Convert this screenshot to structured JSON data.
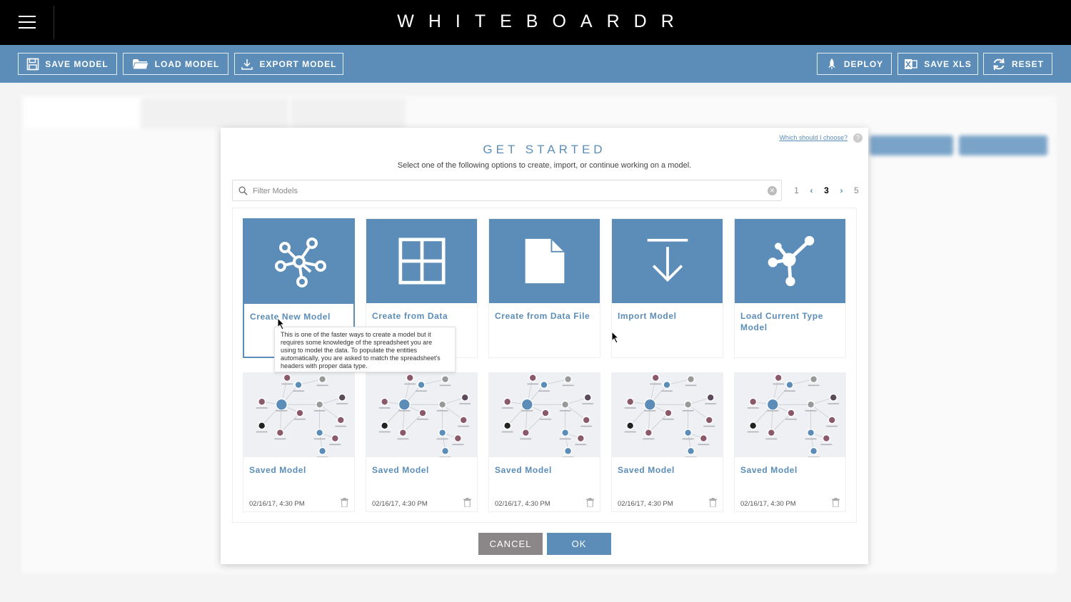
{
  "app": {
    "brand": "WHITEBOARDR"
  },
  "icons": {
    "menu": "hamburger-icon",
    "save": "floppy-icon",
    "load": "folder-icon",
    "export": "download-icon",
    "deploy": "rocket-icon",
    "xls": "excel-icon",
    "reset": "refresh-icon"
  },
  "toolbar": {
    "save_model": "SAVE MODEL",
    "load_model": "LOAD MODEL",
    "export_model": "EXPORT MODEL",
    "deploy": "DEPLOY",
    "save_xls": "SAVE XLS",
    "reset": "RESET"
  },
  "modal": {
    "help_link": "Which should I choose?",
    "title": "GET STARTED",
    "subtitle": "Select one of the following options to create, import, or continue working on a model.",
    "filter_placeholder": "Filter Models",
    "pager": {
      "pages": [
        "1",
        "3",
        "5"
      ],
      "current": "3",
      "prev": "‹",
      "next": "›"
    },
    "options": [
      {
        "label": "Create New Model",
        "icon": "network-icon",
        "selected": true
      },
      {
        "label": "Create from Data Dictionary",
        "icon": "grid-icon"
      },
      {
        "label": "Create from Data File",
        "icon": "file-icon"
      },
      {
        "label": "Import Model",
        "icon": "import-icon"
      },
      {
        "label": "Load Current Type Model",
        "icon": "hub-icon"
      }
    ],
    "saved": [
      {
        "label": "Saved Model",
        "date": "02/16/17, 4:30 PM"
      },
      {
        "label": "Saved Model",
        "date": "02/16/17, 4:30 PM"
      },
      {
        "label": "Saved Model",
        "date": "02/16/17, 4:30 PM"
      },
      {
        "label": "Saved Model",
        "date": "02/16/17, 4:30 PM"
      },
      {
        "label": "Saved Model",
        "date": "02/16/17, 4:30 PM"
      }
    ],
    "tooltip": "This is one of the faster ways to create a model but it requires some knowledge of the spreadsheet you are using to model the data. To populate the entities automatically, you are asked to match the spreadsheet's headers with proper data type.",
    "cancel": "CANCEL",
    "ok": "OK"
  }
}
